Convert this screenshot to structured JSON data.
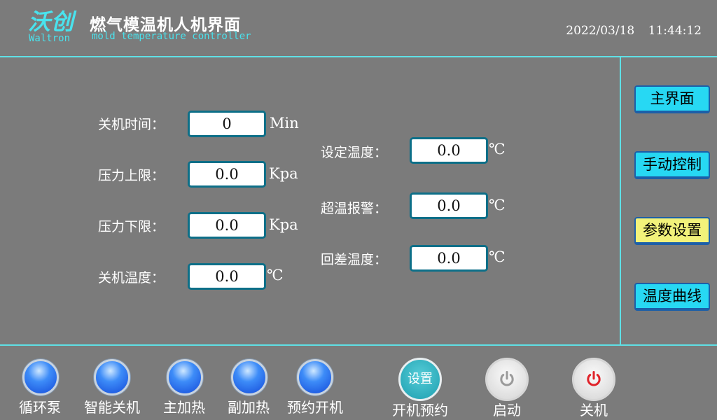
{
  "header": {
    "logo_cn": "沃创",
    "logo_en": "Waltron",
    "title_cn": "燃气模温机人机界面",
    "title_en": "mold temperature controller",
    "date": "2022/03/18",
    "time": "11:44:12"
  },
  "params_left": [
    {
      "label": "关机时间：",
      "value": "0",
      "unit": "Min"
    },
    {
      "label": "压力上限：",
      "value": "0.0",
      "unit": "Kpa"
    },
    {
      "label": "压力下限：",
      "value": "0.0",
      "unit": "Kpa"
    },
    {
      "label": "关机温度：",
      "value": "0.0",
      "unit": "℃"
    }
  ],
  "params_right": [
    {
      "label": "设定温度：",
      "value": "0.0",
      "unit": "℃"
    },
    {
      "label": "超温报警：",
      "value": "0.0",
      "unit": "℃"
    },
    {
      "label": "回差温度：",
      "value": "0.0",
      "unit": "℃"
    }
  ],
  "nav": [
    {
      "label": "主界面"
    },
    {
      "label": "手动控制"
    },
    {
      "label": "参数设置",
      "active": true
    },
    {
      "label": "温度曲线"
    }
  ],
  "indicators": [
    {
      "label": "循环泵"
    },
    {
      "label": "智能关机"
    },
    {
      "label": "主加热"
    },
    {
      "label": "副加热"
    },
    {
      "label": "预约开机"
    }
  ],
  "schedule": {
    "button": "设置",
    "label": "开机预约"
  },
  "start": {
    "label": "启动",
    "icon": "power-icon",
    "color": "#9a9a9a"
  },
  "stop": {
    "label": "关机",
    "icon": "power-icon",
    "color": "#e0232a"
  }
}
